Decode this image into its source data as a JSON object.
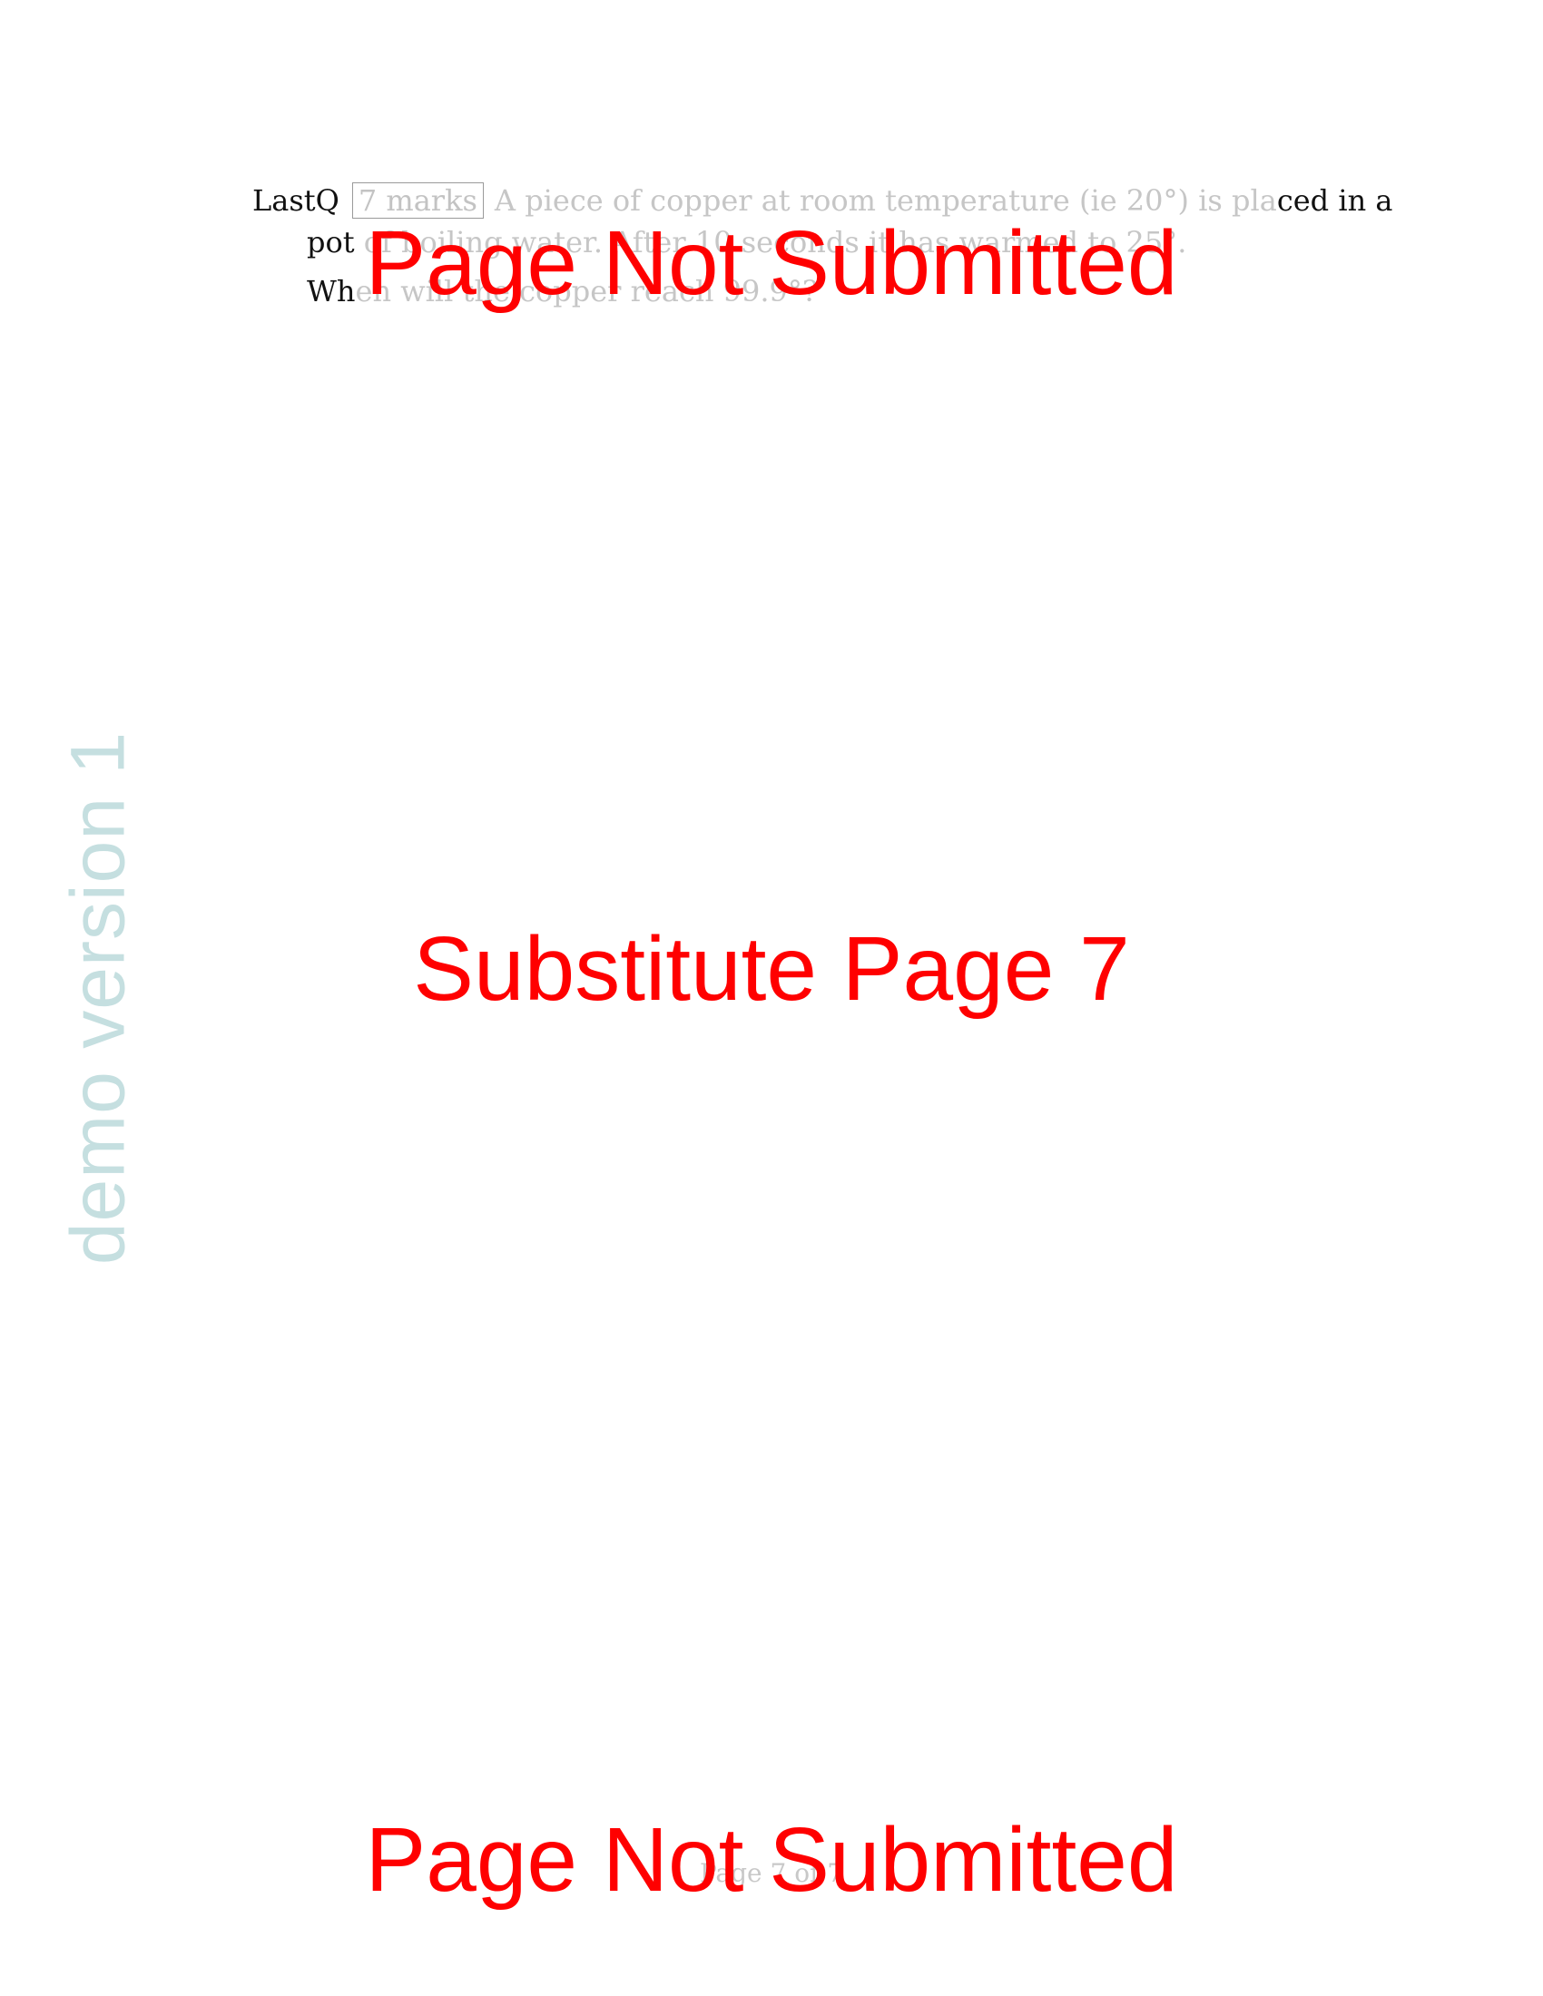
{
  "question": {
    "label": "LastQ",
    "marks": "7 marks",
    "line1_faded": "A piece of copper at room temperature (ie 20°) is pla",
    "line1_dark": "ced in a",
    "line2_dark": "pot",
    "line2_faded": "of boiling water. After 10 seconds it has warmed to 25°.",
    "line3_dark": "Wh",
    "line3_faded": "en will the copper reach 99.9°?"
  },
  "watermark": "demo version 1",
  "stamps": {
    "top": "Page Not Submitted",
    "middle": "Substitute Page 7",
    "bottom": "Page Not Submitted"
  },
  "footer": "Page 7 of 7",
  "colors": {
    "stamp": "#ff0000",
    "watermark": "#c5dfe0",
    "faded_text": "#c6c6c6"
  }
}
